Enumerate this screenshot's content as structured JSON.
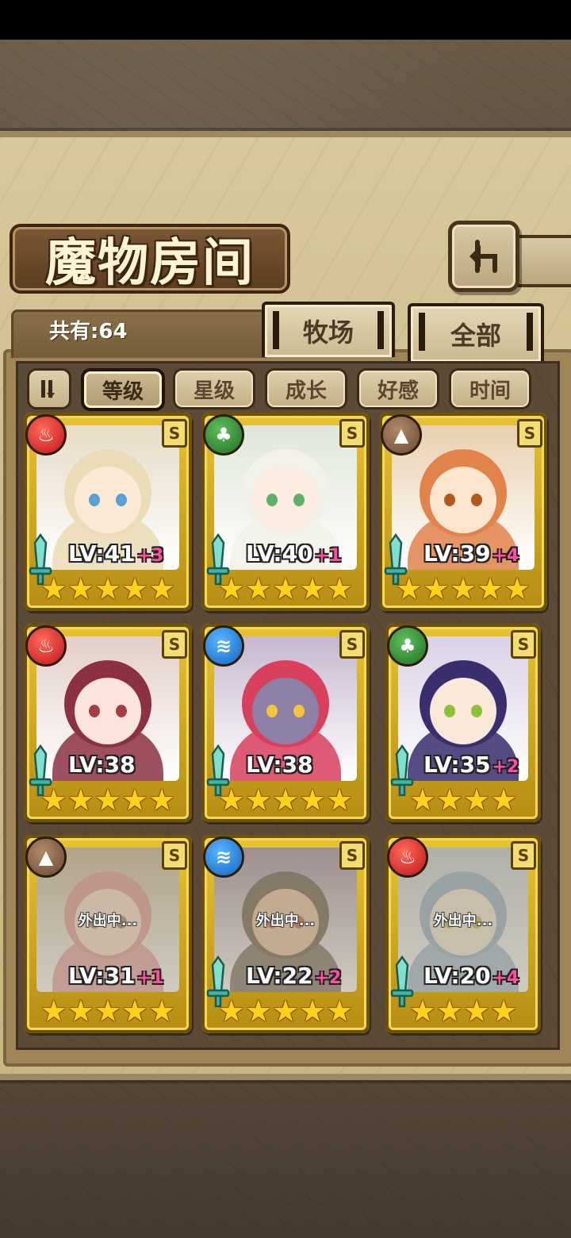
{
  "header": {
    "title": "魔物房间",
    "back_icon": "return-arrow-icon"
  },
  "summary": {
    "count_label": "共有:64"
  },
  "tabs": [
    {
      "label": "牧场",
      "active": false
    },
    {
      "label": "全部",
      "active": true
    }
  ],
  "sort": {
    "toggle_icon": "sort-order-icon",
    "buttons": [
      {
        "label": "等级",
        "active": true
      },
      {
        "label": "星级",
        "active": false
      },
      {
        "label": "成长",
        "active": false
      },
      {
        "label": "好感",
        "active": false
      },
      {
        "label": "时间",
        "active": false
      }
    ]
  },
  "monsters": [
    {
      "element": "fire",
      "level": "LV:41",
      "plus": "+3",
      "stars": 5,
      "away": "",
      "hair": "#eadcb6",
      "skin": "#fbe9d6",
      "eye": "#5a9fd6",
      "bg": "#e7dcc6",
      "sword": true
    },
    {
      "element": "wood",
      "level": "LV:40",
      "plus": "+1",
      "stars": 5,
      "away": "",
      "hair": "#f2f2ea",
      "skin": "#fbeee0",
      "eye": "#5fae6a",
      "bg": "#dfe6d8",
      "sword": true
    },
    {
      "element": "earth",
      "level": "LV:39",
      "plus": "+4",
      "stars": 5,
      "away": "",
      "hair": "#e1834a",
      "skin": "#fbe5cf",
      "eye": "#b2591c",
      "bg": "#e9d0b0",
      "sword": true
    },
    {
      "element": "fire",
      "level": "LV:38",
      "plus": "",
      "stars": 5,
      "away": "",
      "hair": "#8c3142",
      "skin": "#fbe4dc",
      "eye": "#a83c44",
      "bg": "#e3cfc8",
      "sword": true
    },
    {
      "element": "water",
      "level": "LV:38",
      "plus": "",
      "stars": 5,
      "away": "",
      "hair": "#d9405e",
      "skin": "#8c7fa8",
      "eye": "#f4c53a",
      "bg": "#c7b7cf",
      "sword": true
    },
    {
      "element": "wood",
      "level": "LV:35",
      "plus": "+2",
      "stars": 4,
      "away": "",
      "hair": "#3a2e6e",
      "skin": "#fbe8da",
      "eye": "#8ac23a",
      "bg": "#d9d1e6",
      "sword": true
    },
    {
      "element": "earth",
      "level": "LV:31",
      "plus": "+1",
      "stars": 5,
      "away": "外出中...",
      "hair": "#d98a8c",
      "skin": "#f4d6c8",
      "eye": "#8a6a4a",
      "bg": "#b9a888",
      "sword": false
    },
    {
      "element": "water",
      "level": "LV:22",
      "plus": "+2",
      "stars": 5,
      "away": "外出中...",
      "hair": "#5a4a3c",
      "skin": "#e3b89a",
      "eye": "#c04a2a",
      "bg": "#8e7a92",
      "sword": true
    },
    {
      "element": "fire",
      "level": "LV:20",
      "plus": "+4",
      "stars": 4,
      "away": "外出中...",
      "hair": "#86a6c6",
      "skin": "#eee2d2",
      "eye": "#c4a24a",
      "bg": "#b8c4cc",
      "sword": true
    }
  ],
  "card_rarity": "S",
  "element_colors": {
    "fire": "#d41e24",
    "wood": "#2e8a34",
    "earth": "#7a5540",
    "water": "#1c78d8"
  },
  "element_icons": {
    "fire": "flame-icon",
    "wood": "leaf-icon",
    "earth": "mountain-icon",
    "water": "wave-icon"
  },
  "star_glyph": "★"
}
